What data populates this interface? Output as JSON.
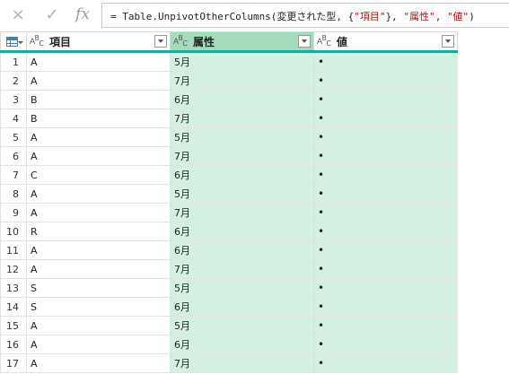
{
  "formula_bar": {
    "cancel_icon": "×",
    "confirm_icon": "✓",
    "fx_label": "fx",
    "formula_prefix": "= Table.UnpivotOtherColumns(変更された型, {",
    "formula_str1": "\"項目\"",
    "formula_mid": "}, ",
    "formula_str2": "\"属性\"",
    "formula_sep": ", ",
    "formula_str3": "\"値\"",
    "formula_suffix": ")"
  },
  "columns": [
    {
      "name": "項目",
      "type_icon": "ABC"
    },
    {
      "name": "属性",
      "type_icon": "ABC"
    },
    {
      "name": "値",
      "type_icon": "ABC"
    }
  ],
  "rows": [
    {
      "n": "1",
      "item": "A",
      "attr": "5月",
      "val": "•"
    },
    {
      "n": "2",
      "item": "A",
      "attr": "7月",
      "val": "•"
    },
    {
      "n": "3",
      "item": "B",
      "attr": "6月",
      "val": "•"
    },
    {
      "n": "4",
      "item": "B",
      "attr": "7月",
      "val": "•"
    },
    {
      "n": "5",
      "item": "A",
      "attr": "5月",
      "val": "•"
    },
    {
      "n": "6",
      "item": "A",
      "attr": "7月",
      "val": "•"
    },
    {
      "n": "7",
      "item": "C",
      "attr": "6月",
      "val": "•"
    },
    {
      "n": "8",
      "item": "A",
      "attr": "5月",
      "val": "•"
    },
    {
      "n": "9",
      "item": "A",
      "attr": "7月",
      "val": "•"
    },
    {
      "n": "10",
      "item": "R",
      "attr": "6月",
      "val": "•"
    },
    {
      "n": "11",
      "item": "A",
      "attr": "6月",
      "val": "•"
    },
    {
      "n": "12",
      "item": "A",
      "attr": "7月",
      "val": "•"
    },
    {
      "n": "13",
      "item": "S",
      "attr": "5月",
      "val": "•"
    },
    {
      "n": "14",
      "item": "S",
      "attr": "6月",
      "val": "•"
    },
    {
      "n": "15",
      "item": "A",
      "attr": "5月",
      "val": "•"
    },
    {
      "n": "16",
      "item": "A",
      "attr": "6月",
      "val": "•"
    },
    {
      "n": "17",
      "item": "A",
      "attr": "7月",
      "val": "•"
    }
  ],
  "colors": {
    "selected_header": "#a3dbbd",
    "selected_cells": "#d5f0e1",
    "header_underline": "#1aab9b"
  }
}
